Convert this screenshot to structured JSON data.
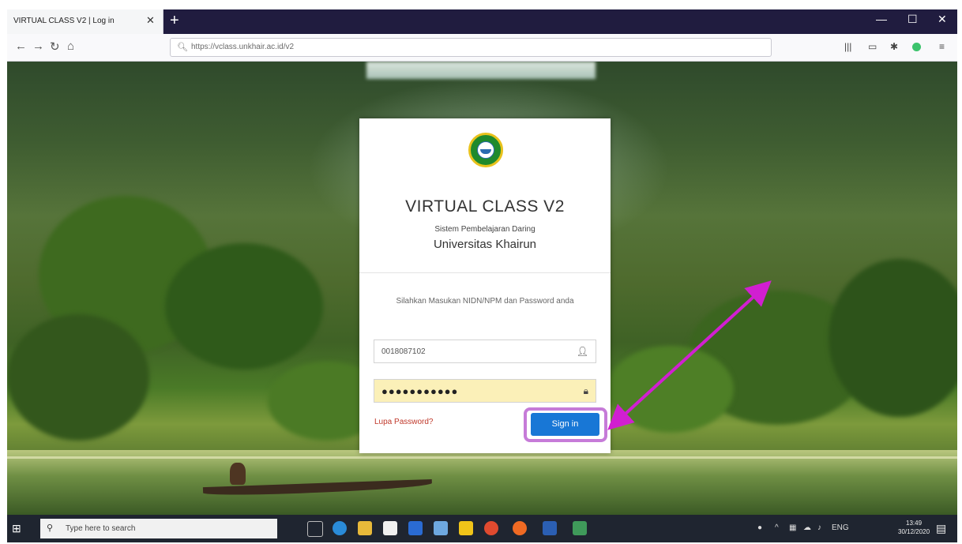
{
  "browser": {
    "tab_title": "VIRTUAL CLASS V2 | Log in",
    "tab_close": "✕",
    "new_tab": "+",
    "url": "https://vclass.unkhair.ac.id/v2",
    "window_min": "—",
    "window_max": "☐",
    "window_close": "✕"
  },
  "card": {
    "title": "VIRTUAL CLASS V2",
    "subtitle": "Sistem Pembelajaran Daring",
    "university": "Universitas Khairun",
    "prompt": "Silahkan Masukan NIDN/NPM dan Password anda",
    "username_value": "0018087102",
    "password_masked": "●●●●●●●●●●●",
    "forgot_label": "Lupa Password?",
    "signin_label": "Sign in"
  },
  "taskbar": {
    "search_placeholder": "Type here to search",
    "time": "13:49",
    "date": "30/12/2020"
  },
  "colors": {
    "accent": "#1877d6",
    "annotation": "#d11fd1",
    "forgot": "#c0392b"
  },
  "icons": [
    "back-icon",
    "forward-icon",
    "reload-icon",
    "home-icon",
    "library-icon",
    "sidebar-icon",
    "extension-icon",
    "menu-icon",
    "user-icon",
    "lock-icon",
    "windows-start-icon",
    "search-icon"
  ]
}
